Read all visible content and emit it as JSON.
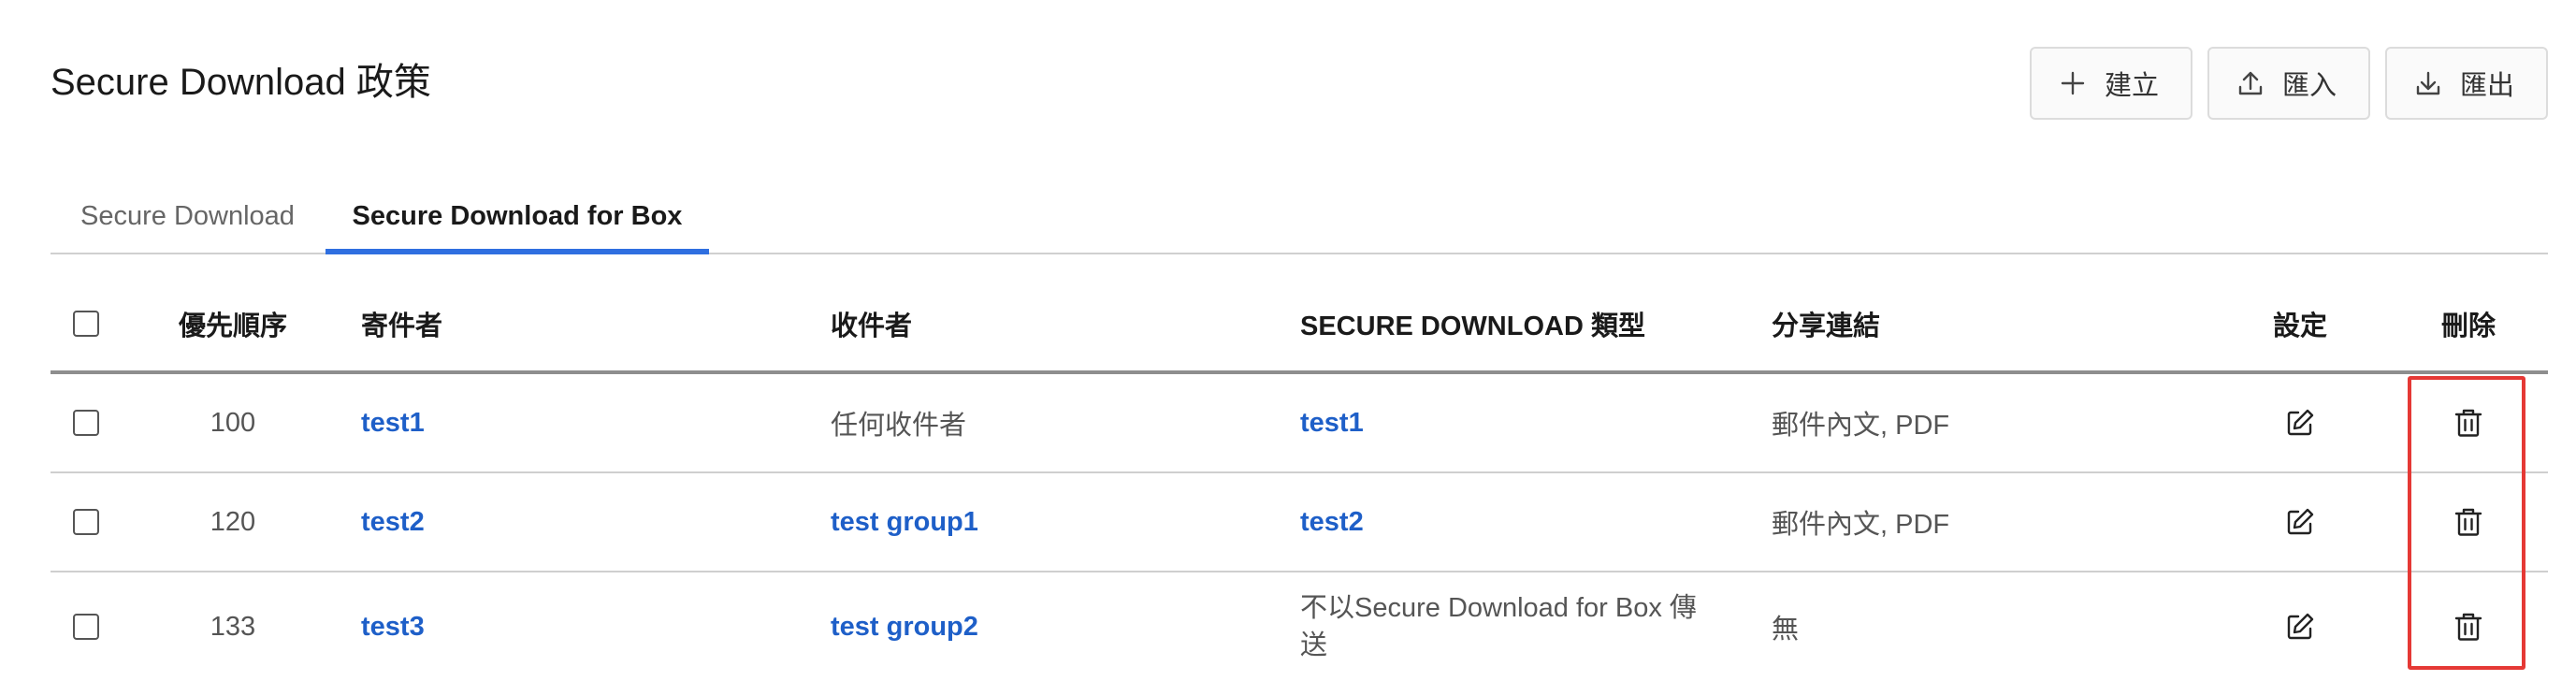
{
  "page": {
    "title": "Secure Download 政策"
  },
  "toolbar": {
    "create_label": "建立",
    "import_label": "匯入",
    "export_label": "匯出"
  },
  "tabs": [
    {
      "label": "Secure Download",
      "active": false
    },
    {
      "label": "Secure Download for Box",
      "active": true
    }
  ],
  "table": {
    "headers": {
      "priority": "優先順序",
      "sender": "寄件者",
      "recipient": "收件者",
      "type": "SECURE DOWNLOAD 類型",
      "share_link": "分享連結",
      "settings": "設定",
      "delete": "刪除"
    },
    "rows": [
      {
        "priority": "100",
        "sender": "test1",
        "recipient": "任何收件者",
        "recipient_is_link": false,
        "type": "test1",
        "type_is_link": true,
        "share_link": "郵件內文, PDF"
      },
      {
        "priority": "120",
        "sender": "test2",
        "recipient": "test group1",
        "recipient_is_link": true,
        "type": "test2",
        "type_is_link": true,
        "share_link": "郵件內文, PDF"
      },
      {
        "priority": "133",
        "sender": "test3",
        "recipient": "test group2",
        "recipient_is_link": true,
        "type": "不以Secure Download for Box 傳送",
        "type_is_link": false,
        "share_link": "無"
      }
    ]
  },
  "colors": {
    "accent": "#2f6fe0",
    "link": "#1e5fc8",
    "highlight": "#e53935"
  },
  "icons": {
    "create": "plus-icon",
    "import": "upload-icon",
    "export": "download-icon",
    "settings": "edit-icon",
    "delete": "trash-icon"
  }
}
